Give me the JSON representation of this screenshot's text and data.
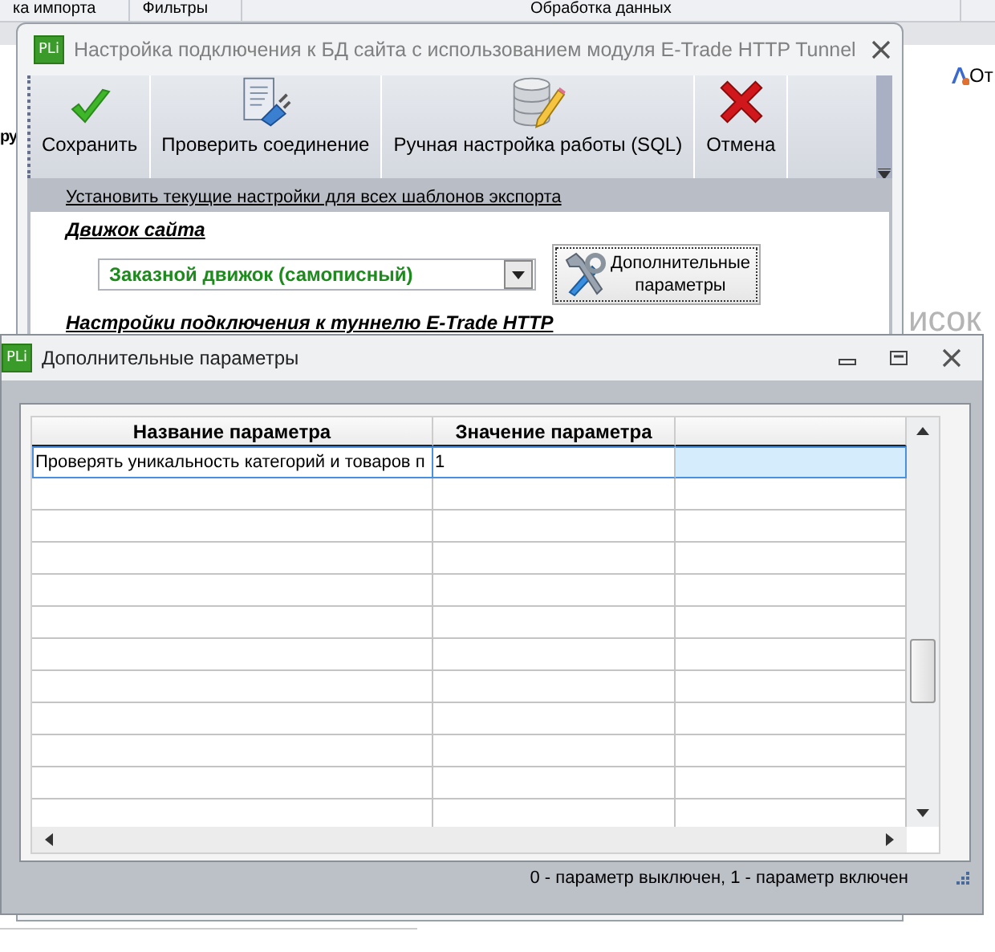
{
  "background": {
    "tabs": [
      "ка импорта",
      "Фильтры",
      "Обработка данных"
    ],
    "left_label": "ру",
    "right_link": "От",
    "right_text": "исок"
  },
  "connection_window": {
    "logo": "PLi",
    "title": "Настройка подключения к БД сайта с использованием модуля E-Trade HTTP Tunnel",
    "toolbar": [
      {
        "label": "Сохранить",
        "kind": "check"
      },
      {
        "label": "Проверить соединение",
        "kind": "plug"
      },
      {
        "label": "Ручная настройка работы (SQL)",
        "kind": "database"
      },
      {
        "label": "Отмена",
        "kind": "cross"
      }
    ],
    "apply_all_link": "Установить текущие настройки для всех шаблонов экспорта",
    "engine_heading": "Движок сайта",
    "engine_select": {
      "value": "Заказной движок (самописный)"
    },
    "extra_params_button": "Дополнительные параметры",
    "tunnel_heading": "Настройки подключения к туннелю E-Trade HTTP"
  },
  "params_window": {
    "logo": "PLi",
    "title": "Дополнительные параметры",
    "grid": {
      "columns": [
        "Название параметра",
        "Значение параметра"
      ],
      "rows": [
        {
          "cells": [
            "Проверять уникальность категорий и товаров п",
            "1"
          ],
          "selected": true
        }
      ]
    },
    "status_text": "0 - параметр выключен, 1 - параметр включен"
  }
}
